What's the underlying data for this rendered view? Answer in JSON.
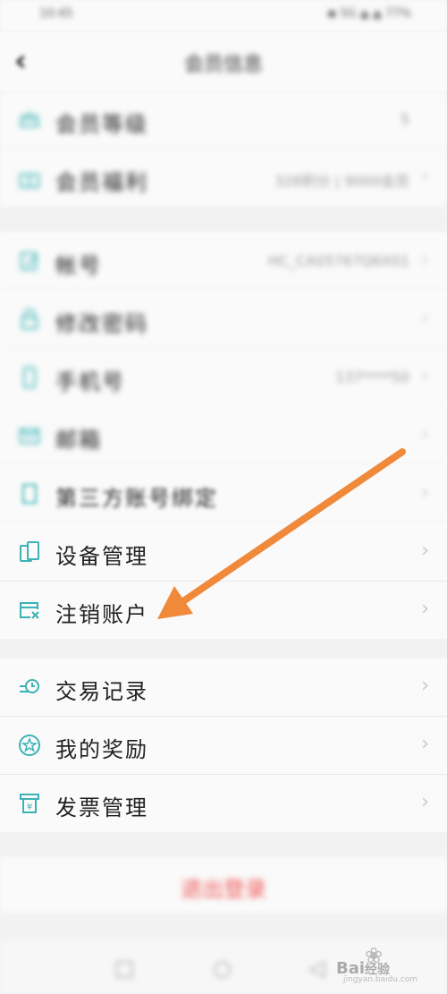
{
  "status_bar": {
    "time": "10:45",
    "right": "◆ 5G ▲ ▲ 77%"
  },
  "header": {
    "back_glyph": "‹",
    "title": "会员信息"
  },
  "group1": [
    {
      "label": "会员等级",
      "value": "5",
      "icon": "crown-icon"
    },
    {
      "label": "会员福利",
      "value": "328积分 | 9000会员",
      "icon": "gift-icon"
    }
  ],
  "group2": [
    {
      "label": "帐号",
      "value": "HC_CA05767Q6X01",
      "icon": "edit-icon"
    },
    {
      "label": "修改密码",
      "value": "",
      "icon": "lock-icon"
    },
    {
      "label": "手机号",
      "value": "137****50",
      "icon": "phone-icon"
    },
    {
      "label": "邮箱",
      "value": "",
      "icon": "mail-icon"
    },
    {
      "label": "第三方账号绑定",
      "value": "",
      "icon": "link-icon"
    },
    {
      "label": "设备管理",
      "value": "",
      "icon": "device-icon"
    },
    {
      "label": "注销账户",
      "value": "",
      "icon": "deregister-icon"
    }
  ],
  "group3": [
    {
      "label": "交易记录",
      "value": "",
      "icon": "transaction-icon"
    },
    {
      "label": "我的奖励",
      "value": "",
      "icon": "reward-icon"
    },
    {
      "label": "发票管理",
      "value": "",
      "icon": "invoice-icon"
    }
  ],
  "chevron": "›",
  "logout": {
    "label": "退出登录"
  },
  "nav_keys": {
    "recent": "□",
    "home": "○",
    "back": "◁"
  },
  "watermark": {
    "brand": "Bai",
    "brand_cn": "经验",
    "url": "jingyan.baidu.com"
  },
  "colors": {
    "accent_icon": "#3bb3b5",
    "logout": "#f05555",
    "arrow": "#f0893a"
  }
}
